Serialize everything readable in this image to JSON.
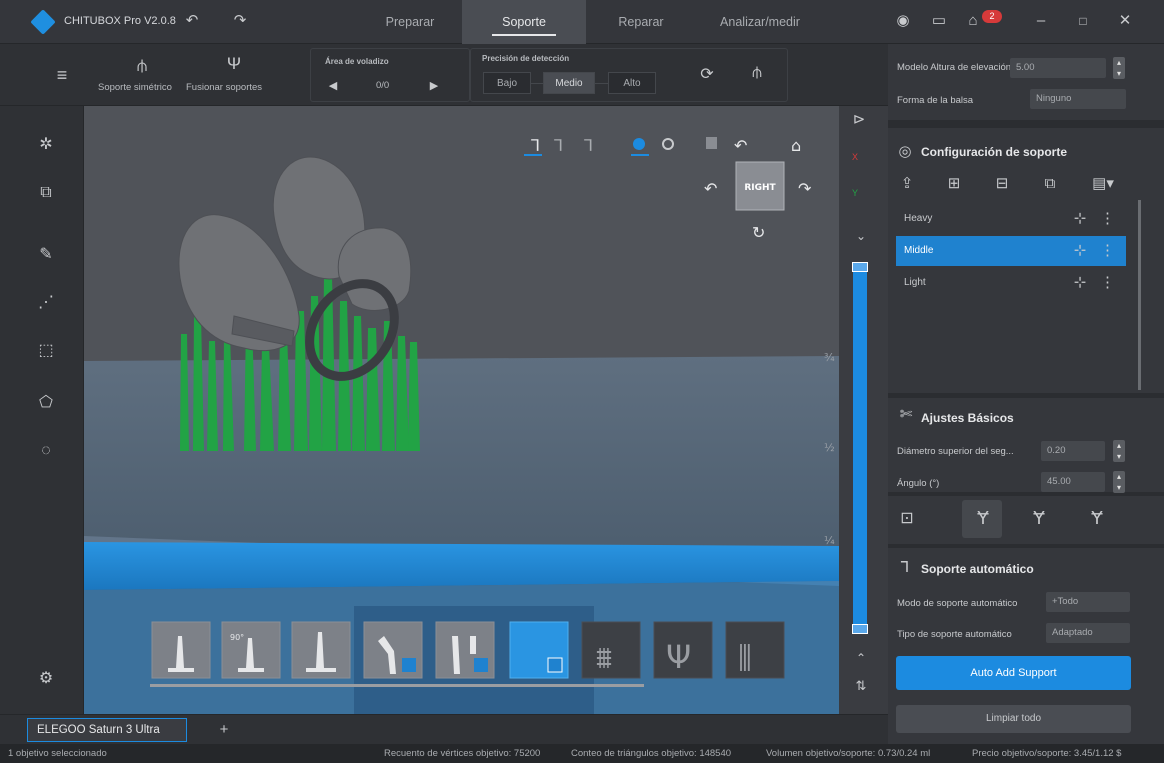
{
  "app": {
    "title": "CHITUBOX Pro V2.0.8",
    "notif_count": "2"
  },
  "top_tabs": [
    "Preparar",
    "Soporte",
    "Reparar",
    "Analizar/medir"
  ],
  "toolbar": {
    "symmetric_label": "Soporte simétrico",
    "merge_label": "Fusionar soportes",
    "overhang_title": "Área de voladizo",
    "overhang_value": "0/0",
    "precision_title": "Precisión de detección",
    "precision_options": [
      "Bajo",
      "Medio",
      "Alto"
    ],
    "precision_selected": "Medio"
  },
  "right_panel": {
    "lift_label": "Modelo Altura de elevación (mm)",
    "lift_value": "5.00",
    "raft_label": "Forma de la balsa",
    "raft_value": "Ninguno",
    "support_config_title": "Configuración de soporte",
    "profiles": [
      "Heavy",
      "Middle",
      "Light"
    ],
    "selected_profile": "Middle",
    "basic_title": "Ajustes Básicos",
    "top_diameter_label": "Diámetro superior del seg...",
    "top_diameter_value": "0.20",
    "angle_label": "Ángulo (°)",
    "angle_value": "45.00",
    "auto_title": "Soporte automático",
    "auto_mode_label": "Modo de soporte automático",
    "auto_mode_value": "+Todo",
    "auto_type_label": "Tipo de soporte automático",
    "auto_type_value": "Adaptado",
    "auto_add_button": "Auto Add Support",
    "clear_button": "Limpiar todo"
  },
  "viewport": {
    "cube_face": "RIGHT",
    "scale_marks": [
      "¾",
      "½",
      "¼"
    ],
    "axis_x": "X",
    "axis_y": "Y"
  },
  "bottom": {
    "printer_tab": "ELEGOO Saturn 3 Ultra",
    "add_tab": "+"
  },
  "status": {
    "selected": "1 objetivo seleccionado",
    "vertices": "Recuento de vértices objetivo: 75200",
    "triangles": "Conteo de triángulos objetivo: 148540",
    "volume": "Volumen objetivo/soporte: 0.73/0.24 ml",
    "price": "Precio objetivo/soporte: 3.45/1.12 $"
  },
  "colors": {
    "accent": "#1c8be0",
    "support_green": "#22a345",
    "model_grey": "#6f7175",
    "plate_blue": "#2a95e2"
  }
}
